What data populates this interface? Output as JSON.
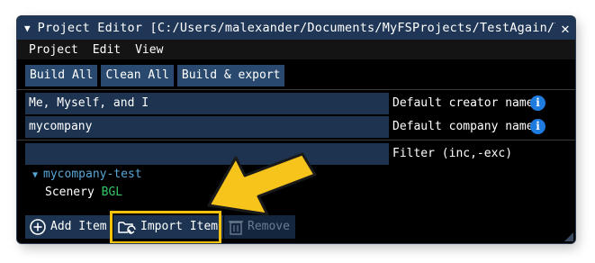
{
  "window": {
    "title": "Project Editor [C:/Users/malexander/Documents/MyFSProjects/TestAgain/Test/test/",
    "close_glyph": "✕"
  },
  "menu": [
    "Project",
    "Edit",
    "View"
  ],
  "toolbar": {
    "build_all": "Build All",
    "clean_all": "Clean All",
    "build_export": "Build & export"
  },
  "fields": {
    "creator_value": "Me, Myself, and I",
    "creator_label": "Default creator name",
    "company_value": "mycompany",
    "company_label": "Default company name",
    "filter_value": "",
    "filter_label": "Filter (inc,-exc)",
    "info_glyph": "i"
  },
  "tree": {
    "project": "mycompany-test",
    "item_name": "Scenery",
    "item_tag": "BGL"
  },
  "actions": {
    "add_item": "Add Item",
    "import_item": "Import Item",
    "remove": "Remove"
  },
  "colors": {
    "titlebar": "#1f3656",
    "button": "#294a6e",
    "field": "#1d3350",
    "info": "#1e7be0",
    "tree_node": "#56a6d6",
    "tag": "#33c766",
    "highlight": "#f4c20d"
  }
}
